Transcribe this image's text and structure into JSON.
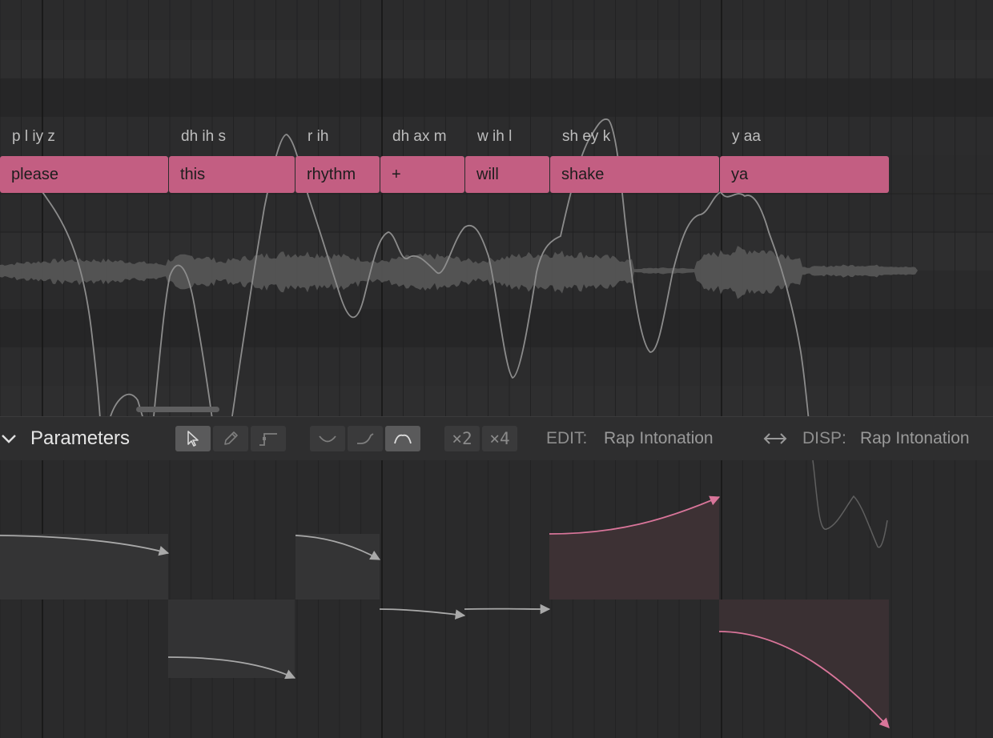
{
  "notes": [
    {
      "lyric": "please",
      "phonemes": "p l iy z"
    },
    {
      "lyric": "this",
      "phonemes": "dh ih s"
    },
    {
      "lyric": "rhythm",
      "phonemes": "r ih"
    },
    {
      "lyric": "+",
      "phonemes": "dh ax m"
    },
    {
      "lyric": "will",
      "phonemes": "w ih l"
    },
    {
      "lyric": "shake",
      "phonemes": "sh ey k"
    },
    {
      "lyric": "ya",
      "phonemes": "y aa"
    }
  ],
  "panel": {
    "title": "Parameters",
    "tools": [
      {
        "name": "select-tool",
        "icon": "pointer-arrow-icon",
        "active": true
      },
      {
        "name": "pencil-tool",
        "icon": "pencil-icon",
        "active": false
      },
      {
        "name": "line-tool",
        "icon": "line-step-icon",
        "active": false
      }
    ],
    "curve_modes": [
      {
        "name": "curve-dip-mode",
        "icon": "dip-curve-icon",
        "active": false
      },
      {
        "name": "curve-rise-mode",
        "icon": "rise-curve-icon",
        "active": false
      },
      {
        "name": "curve-arch-mode",
        "icon": "arch-curve-icon",
        "active": true
      }
    ],
    "multipliers": [
      "×2",
      "×4"
    ],
    "edit_label": "EDIT:",
    "edit_value": "Rap Intonation",
    "disp_label": "DISP:",
    "disp_value": "Rap Intonation"
  },
  "colors": {
    "note": "#c35e82",
    "accent_curve": "#d9759a",
    "pitch_curve": "#8c8c8c",
    "waveform": "#585858"
  }
}
